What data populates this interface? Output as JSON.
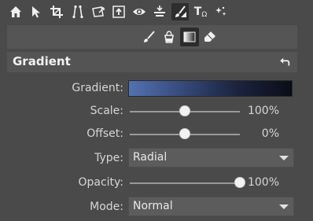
{
  "toolbar": {
    "tools": [
      {
        "name": "home-icon"
      },
      {
        "name": "cursor-icon"
      },
      {
        "name": "crop-icon"
      },
      {
        "name": "perspective-icon"
      },
      {
        "name": "transform-icon"
      },
      {
        "name": "export-icon"
      },
      {
        "name": "eye-icon"
      },
      {
        "name": "level-icon"
      },
      {
        "name": "brush-mask-icon",
        "active": true
      },
      {
        "name": "text-icon",
        "text": "T",
        "sub": "Ω"
      },
      {
        "name": "effects-icon"
      }
    ]
  },
  "subtoolbar": {
    "tools": [
      {
        "name": "brush-icon"
      },
      {
        "name": "bucket-icon"
      },
      {
        "name": "gradient-tool-icon",
        "active": true
      },
      {
        "name": "eraser-icon"
      }
    ]
  },
  "panel": {
    "title": "Gradient",
    "gradient_label": "Gradient:",
    "gradient_colors": [
      "#5272b0",
      "#0b0d16"
    ],
    "scale": {
      "label": "Scale:",
      "value_text": "100%",
      "fraction": 0.5
    },
    "offset": {
      "label": "Offset:",
      "value_text": "0%",
      "fraction": 0.5
    },
    "type": {
      "label": "Type:",
      "value": "Radial"
    },
    "opacity": {
      "label": "Opacity:",
      "value_text": "100%",
      "fraction": 1.0
    },
    "mode": {
      "label": "Mode:",
      "value": "Normal"
    }
  },
  "colors": {
    "background": "#4a4a4a",
    "panel": "#545454",
    "active_tool": "#2e2e2e"
  }
}
